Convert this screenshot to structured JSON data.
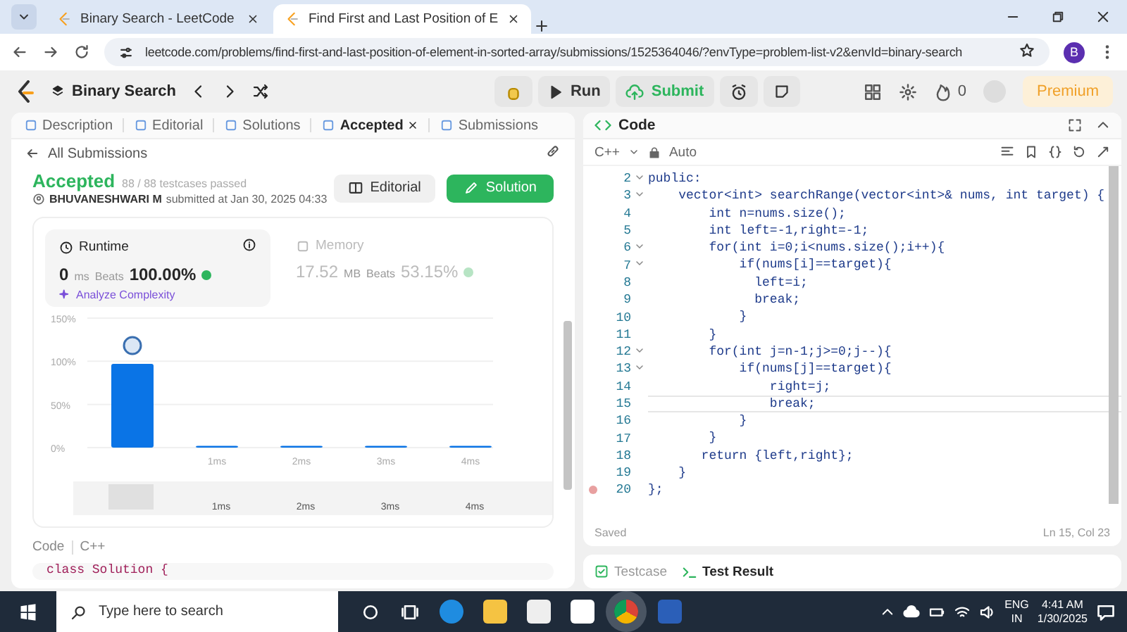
{
  "browser": {
    "tabs": [
      {
        "title": "Binary Search - LeetCode",
        "selected": false
      },
      {
        "title": "Find First and Last Position of E",
        "selected": true
      }
    ],
    "url": "leetcode.com/problems/find-first-and-last-position-of-element-in-sorted-array/submissions/1525364046/?envType=problem-list-v2&envId=binary-search",
    "profile_initial": "B"
  },
  "header": {
    "problem_list": "Binary Search",
    "run": "Run",
    "submit": "Submit",
    "streak": "0",
    "premium": "Premium"
  },
  "left_tabs": [
    {
      "label": "Description",
      "selected": false,
      "closable": false
    },
    {
      "label": "Editorial",
      "selected": false,
      "closable": false
    },
    {
      "label": "Solutions",
      "selected": false,
      "closable": false
    },
    {
      "label": "Accepted",
      "selected": true,
      "closable": true
    },
    {
      "label": "Submissions",
      "selected": false,
      "closable": false
    }
  ],
  "back_link": "All Submissions",
  "submission": {
    "status": "Accepted",
    "testcases": "88 / 88 testcases passed",
    "user": "BHUVANESHWARI M",
    "submitted": "submitted at Jan 30, 2025 04:33",
    "editorial_button": "Editorial",
    "solution_button": "Solution"
  },
  "stats": [
    {
      "label": "Runtime",
      "value": "0",
      "unit": "ms",
      "beats_label": "Beats",
      "beats": "100.00%",
      "selected": true,
      "analyze": "Analyze Complexity"
    },
    {
      "label": "Memory",
      "value": "17.52",
      "unit": "MB",
      "beats_label": "Beats",
      "beats": "53.15%",
      "selected": false
    }
  ],
  "chart": {
    "chart_data": {
      "type": "bar",
      "categories": [
        null,
        "1ms",
        "2ms",
        "3ms",
        "4ms"
      ],
      "values": [
        97,
        2,
        2,
        2,
        2
      ],
      "ylim": [
        0,
        150
      ],
      "yticks": [
        {
          "value": 0,
          "label": "0%"
        },
        {
          "value": 50,
          "label": "50%"
        },
        {
          "value": 100,
          "label": "100%"
        },
        {
          "value": 150,
          "label": "150%"
        }
      ]
    },
    "overview_labels": [
      "1ms",
      "2ms",
      "3ms",
      "4ms"
    ]
  },
  "code_preview": {
    "label": "Code",
    "language": "C++",
    "first_line": "class Solution {"
  },
  "editor": {
    "title": "Code",
    "language": "C++",
    "mode": "Auto",
    "status": "Saved",
    "cursor": "Ln 15, Col 23",
    "lines": [
      {
        "number": "2",
        "text": "public:",
        "fold": true,
        "current": false,
        "breakpoint": false
      },
      {
        "number": "3",
        "text": "    vector<int> searchRange(vector<int>& nums, int target) {",
        "fold": true,
        "current": false,
        "breakpoint": false
      },
      {
        "number": "4",
        "text": "        int n=nums.size();",
        "fold": false,
        "current": false,
        "breakpoint": false
      },
      {
        "number": "5",
        "text": "        int left=-1,right=-1;",
        "fold": false,
        "current": false,
        "breakpoint": false
      },
      {
        "number": "6",
        "text": "        for(int i=0;i<nums.size();i++){",
        "fold": true,
        "current": false,
        "breakpoint": false
      },
      {
        "number": "7",
        "text": "            if(nums[i]==target){",
        "fold": true,
        "current": false,
        "breakpoint": false
      },
      {
        "number": "8",
        "text": "              left=i;",
        "fold": false,
        "current": false,
        "breakpoint": false
      },
      {
        "number": "9",
        "text": "              break;",
        "fold": false,
        "current": false,
        "breakpoint": false
      },
      {
        "number": "10",
        "text": "            }",
        "fold": false,
        "current": false,
        "breakpoint": false
      },
      {
        "number": "11",
        "text": "        }",
        "fold": false,
        "current": false,
        "breakpoint": false
      },
      {
        "number": "12",
        "text": "        for(int j=n-1;j>=0;j--){",
        "fold": true,
        "current": false,
        "breakpoint": false
      },
      {
        "number": "13",
        "text": "            if(nums[j]==target){",
        "fold": true,
        "current": false,
        "breakpoint": false
      },
      {
        "number": "14",
        "text": "                right=j;",
        "fold": false,
        "current": false,
        "breakpoint": false
      },
      {
        "number": "15",
        "text": "                break;",
        "fold": false,
        "current": true,
        "breakpoint": false
      },
      {
        "number": "16",
        "text": "            }",
        "fold": false,
        "current": false,
        "breakpoint": false
      },
      {
        "number": "17",
        "text": "        }",
        "fold": false,
        "current": false,
        "breakpoint": false
      },
      {
        "number": "18",
        "text": "       return {left,right};",
        "fold": false,
        "current": false,
        "breakpoint": false
      },
      {
        "number": "19",
        "text": "    }",
        "fold": false,
        "current": false,
        "breakpoint": false
      },
      {
        "number": "20",
        "text": "};",
        "fold": false,
        "current": false,
        "breakpoint": true
      }
    ]
  },
  "bottom_tabs": [
    {
      "label": "Testcase",
      "selected": false
    },
    {
      "label": "Test Result",
      "selected": true
    }
  ],
  "taskbar": {
    "search_placeholder": "Type here to search",
    "language": "ENG",
    "region": "IN",
    "time": "4:41 AM",
    "date": "1/30/2025"
  }
}
